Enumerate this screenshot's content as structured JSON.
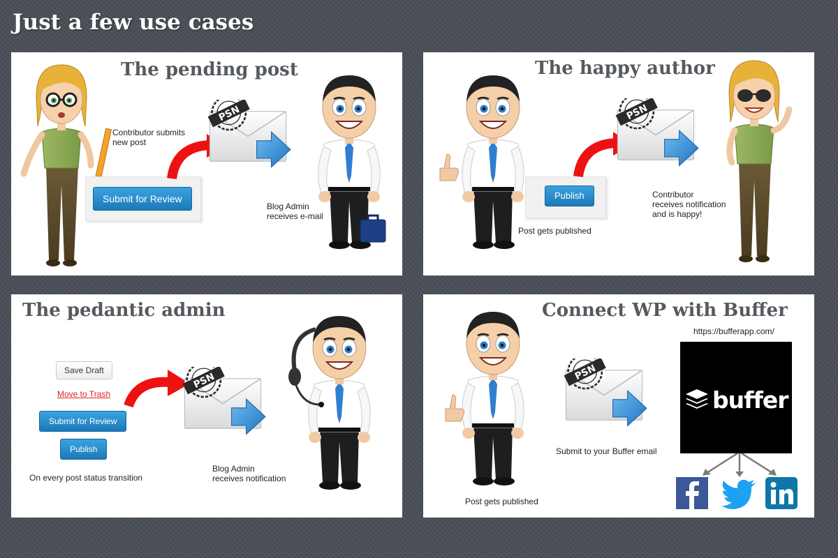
{
  "page": {
    "title": "Just a few use cases"
  },
  "panels": [
    {
      "title": "The pending post",
      "caption_submit": "Contributor submits\nnew post",
      "button": "Submit for Review",
      "caption_admin": "Blog Admin\nreceives e-mail",
      "envelope_label": "PSN"
    },
    {
      "title": "The happy author",
      "button": "Publish",
      "caption_published": "Post gets published",
      "caption_contributor": "Contributor\nreceives notification\nand is happy!",
      "envelope_label": "PSN"
    },
    {
      "title": "The pedantic admin",
      "buttons": {
        "save_draft": "Save Draft",
        "move_to_trash": "Move to Trash",
        "submit_for_review": "Submit for Review",
        "publish": "Publish"
      },
      "caption_transition": "On every post status transition",
      "caption_admin": "Blog Admin\nreceives notification",
      "envelope_label": "PSN"
    },
    {
      "title": "Connect WP with Buffer",
      "buffer_url": "https://bufferapp.com/",
      "buffer_logo": "buffer",
      "caption_submit": "Submit to your Buffer email",
      "caption_published": "Post gets published",
      "envelope_label": "PSN",
      "social": [
        "facebook",
        "twitter",
        "linkedin"
      ]
    }
  ],
  "colors": {
    "background": "#4b4f57",
    "title_text": "#555a5f",
    "wp_button": "#2a8ccc",
    "arrow_red": "#ee1111",
    "arrow_blue": "#2a86d6",
    "facebook": "#3b5998",
    "twitter": "#1da1f2",
    "linkedin": "#0e76a8"
  },
  "icons": [
    "woman-contributor-icon",
    "businessman-admin-icon",
    "envelope-icon",
    "psn-stamp-icon",
    "buffer-logo-icon",
    "facebook-icon",
    "twitter-icon",
    "linkedin-icon"
  ]
}
